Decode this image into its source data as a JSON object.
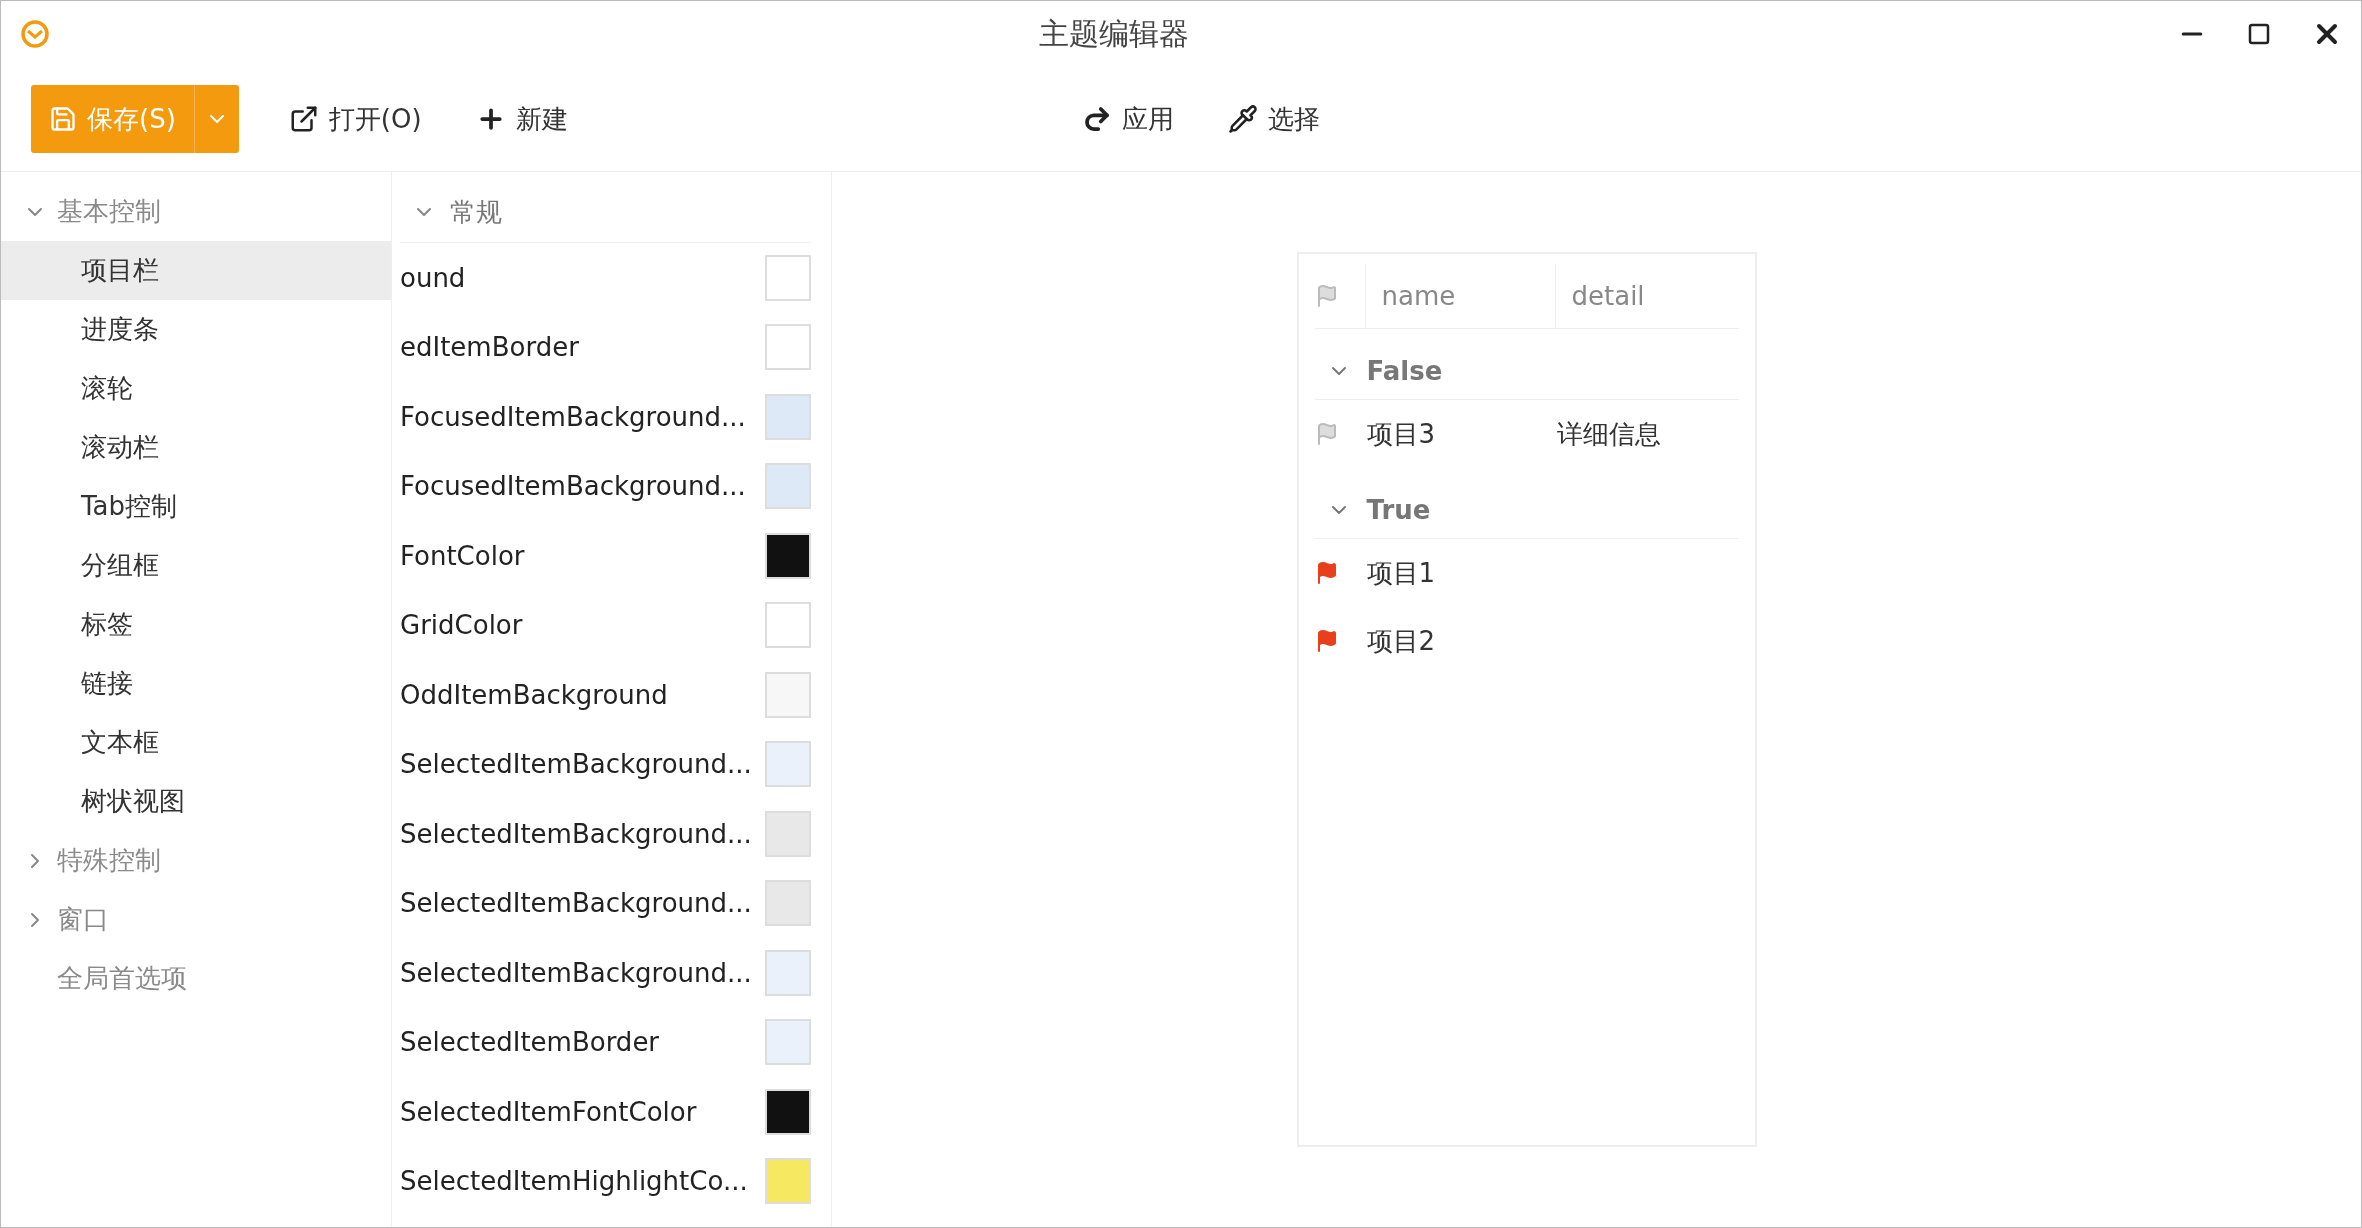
{
  "window": {
    "title": "主题编辑器"
  },
  "toolbar": {
    "left": [
      {
        "kind": "save",
        "label": "保存(S)"
      },
      {
        "kind": "open",
        "label": "打开(O)"
      },
      {
        "kind": "new",
        "label": "新建"
      }
    ],
    "right": [
      {
        "kind": "apply",
        "label": "应用"
      },
      {
        "kind": "pick",
        "label": "选择"
      }
    ]
  },
  "sidebar": {
    "items": [
      {
        "label": "基本控制",
        "kind": "group",
        "expanded": true,
        "children": [
          {
            "label": "项目栏",
            "selected": true
          },
          {
            "label": "进度条",
            "selected": false
          },
          {
            "label": "滚轮",
            "selected": false
          },
          {
            "label": "滚动栏",
            "selected": false
          },
          {
            "label": "Tab控制",
            "selected": false
          },
          {
            "label": "分组框",
            "selected": false
          },
          {
            "label": "标签",
            "selected": false
          },
          {
            "label": "链接",
            "selected": false
          },
          {
            "label": "文本框",
            "selected": false
          },
          {
            "label": "树状视图",
            "selected": false
          }
        ]
      },
      {
        "label": "特殊控制",
        "kind": "group",
        "expanded": false
      },
      {
        "label": "窗口",
        "kind": "group",
        "expanded": false
      },
      {
        "label": "全局首选项",
        "kind": "leaf"
      }
    ]
  },
  "properties": {
    "section": "常规",
    "expanded": true,
    "rows": [
      {
        "name": "ound",
        "color": "#ffffff"
      },
      {
        "name": "edItemBorder",
        "color": "#ffffff"
      },
      {
        "name": "FocusedItemBackground...",
        "color": "#dde9f7"
      },
      {
        "name": "FocusedItemBackground...",
        "color": "#dde9f7"
      },
      {
        "name": "FontColor",
        "color": "#111111"
      },
      {
        "name": "GridColor",
        "color": "#ffffff"
      },
      {
        "name": "OddItemBackground",
        "color": "#f7f7f7"
      },
      {
        "name": "SelectedItemBackground...",
        "color": "#eaf1fa"
      },
      {
        "name": "SelectedItemBackground...",
        "color": "#e8e8e8"
      },
      {
        "name": "SelectedItemBackground...",
        "color": "#e8e8e8"
      },
      {
        "name": "SelectedItemBackground...",
        "color": "#eaf1fa"
      },
      {
        "name": "SelectedItemBorder",
        "color": "#eaf1fa"
      },
      {
        "name": "SelectedItemFontColor",
        "color": "#111111"
      },
      {
        "name": "SelectedItemHighlightCo...",
        "color": "#f6e860"
      }
    ]
  },
  "preview": {
    "columns": [
      "name",
      "detail"
    ],
    "groups": [
      {
        "label": "False",
        "expanded": true,
        "rows": [
          {
            "name": "项目3",
            "detail": "详细信息",
            "flagged": false
          }
        ]
      },
      {
        "label": "True",
        "expanded": true,
        "rows": [
          {
            "name": "项目1",
            "flagged": true
          },
          {
            "name": "项目2",
            "flagged": true
          }
        ]
      }
    ]
  }
}
